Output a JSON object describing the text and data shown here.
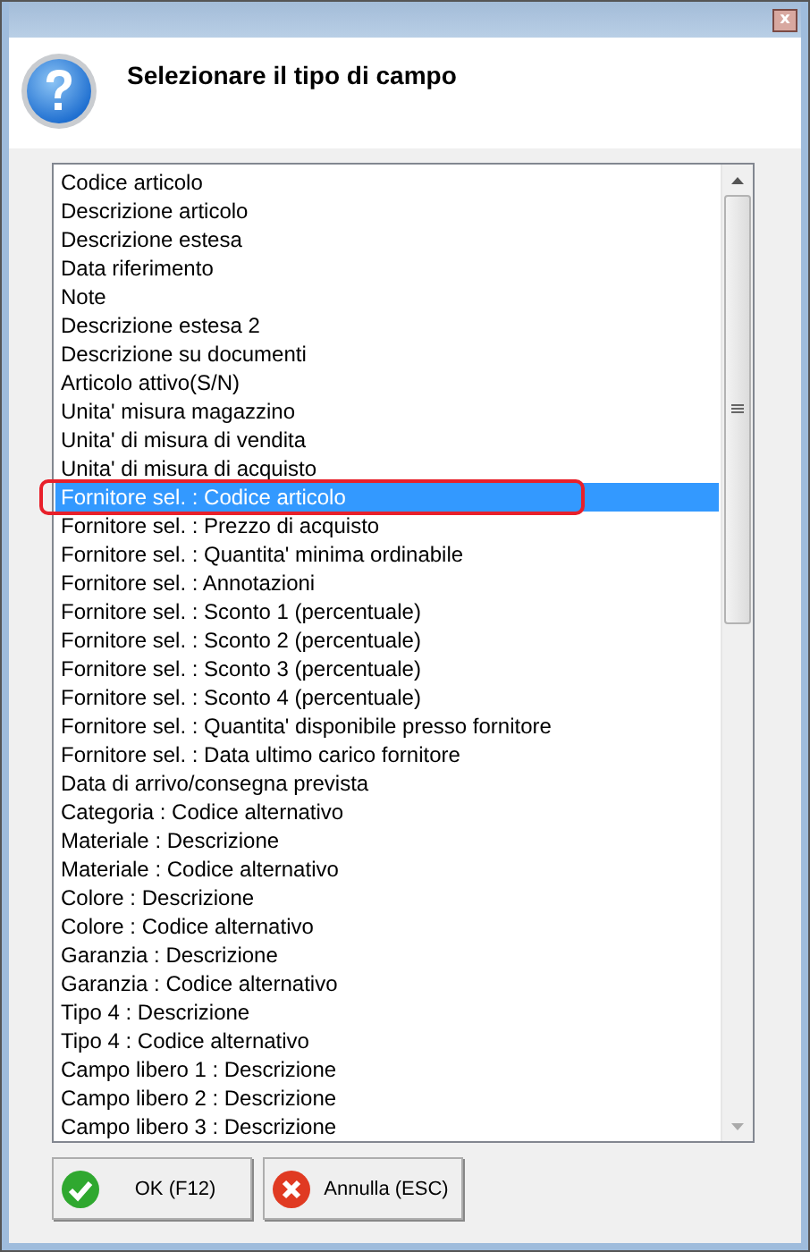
{
  "window": {
    "close_symbol": "x"
  },
  "header": {
    "title": "Selezionare il tipo di campo"
  },
  "list": {
    "items": [
      {
        "label": "Codice articolo",
        "selected": false
      },
      {
        "label": "Descrizione articolo",
        "selected": false
      },
      {
        "label": "Descrizione estesa",
        "selected": false
      },
      {
        "label": "Data riferimento",
        "selected": false
      },
      {
        "label": "Note",
        "selected": false
      },
      {
        "label": "Descrizione estesa 2",
        "selected": false
      },
      {
        "label": "Descrizione su documenti",
        "selected": false
      },
      {
        "label": "Articolo attivo(S/N)",
        "selected": false
      },
      {
        "label": "Unita' misura magazzino",
        "selected": false
      },
      {
        "label": "Unita' di misura di vendita",
        "selected": false
      },
      {
        "label": "Unita' di misura di acquisto",
        "selected": false
      },
      {
        "label": "Fornitore sel. : Codice articolo",
        "selected": true
      },
      {
        "label": "Fornitore sel. : Prezzo di acquisto",
        "selected": false
      },
      {
        "label": "Fornitore sel. : Quantita' minima ordinabile",
        "selected": false
      },
      {
        "label": "Fornitore sel. : Annotazioni",
        "selected": false
      },
      {
        "label": "Fornitore sel. : Sconto 1 (percentuale)",
        "selected": false
      },
      {
        "label": "Fornitore sel. : Sconto 2 (percentuale)",
        "selected": false
      },
      {
        "label": "Fornitore sel. : Sconto 3 (percentuale)",
        "selected": false
      },
      {
        "label": "Fornitore sel. : Sconto 4 (percentuale)",
        "selected": false
      },
      {
        "label": "Fornitore sel. : Quantita' disponibile presso fornitore",
        "selected": false
      },
      {
        "label": "Fornitore sel. : Data ultimo carico fornitore",
        "selected": false
      },
      {
        "label": "Data di arrivo/consegna prevista",
        "selected": false
      },
      {
        "label": "Categoria : Codice alternativo",
        "selected": false
      },
      {
        "label": "Materiale : Descrizione",
        "selected": false
      },
      {
        "label": "Materiale : Codice alternativo",
        "selected": false
      },
      {
        "label": "Colore : Descrizione",
        "selected": false
      },
      {
        "label": "Colore : Codice alternativo",
        "selected": false
      },
      {
        "label": "Garanzia : Descrizione",
        "selected": false
      },
      {
        "label": "Garanzia : Codice alternativo",
        "selected": false
      },
      {
        "label": "Tipo 4 : Descrizione",
        "selected": false
      },
      {
        "label": "Tipo 4 : Codice alternativo",
        "selected": false
      },
      {
        "label": "Campo libero 1 : Descrizione",
        "selected": false
      },
      {
        "label": "Campo libero 2 : Descrizione",
        "selected": false
      },
      {
        "label": "Campo libero 3 : Descrizione",
        "selected": false
      }
    ]
  },
  "buttons": [
    {
      "kind": "ok",
      "label": "OK (F12)"
    },
    {
      "kind": "cancel",
      "label": "Annulla (ESC)"
    }
  ]
}
